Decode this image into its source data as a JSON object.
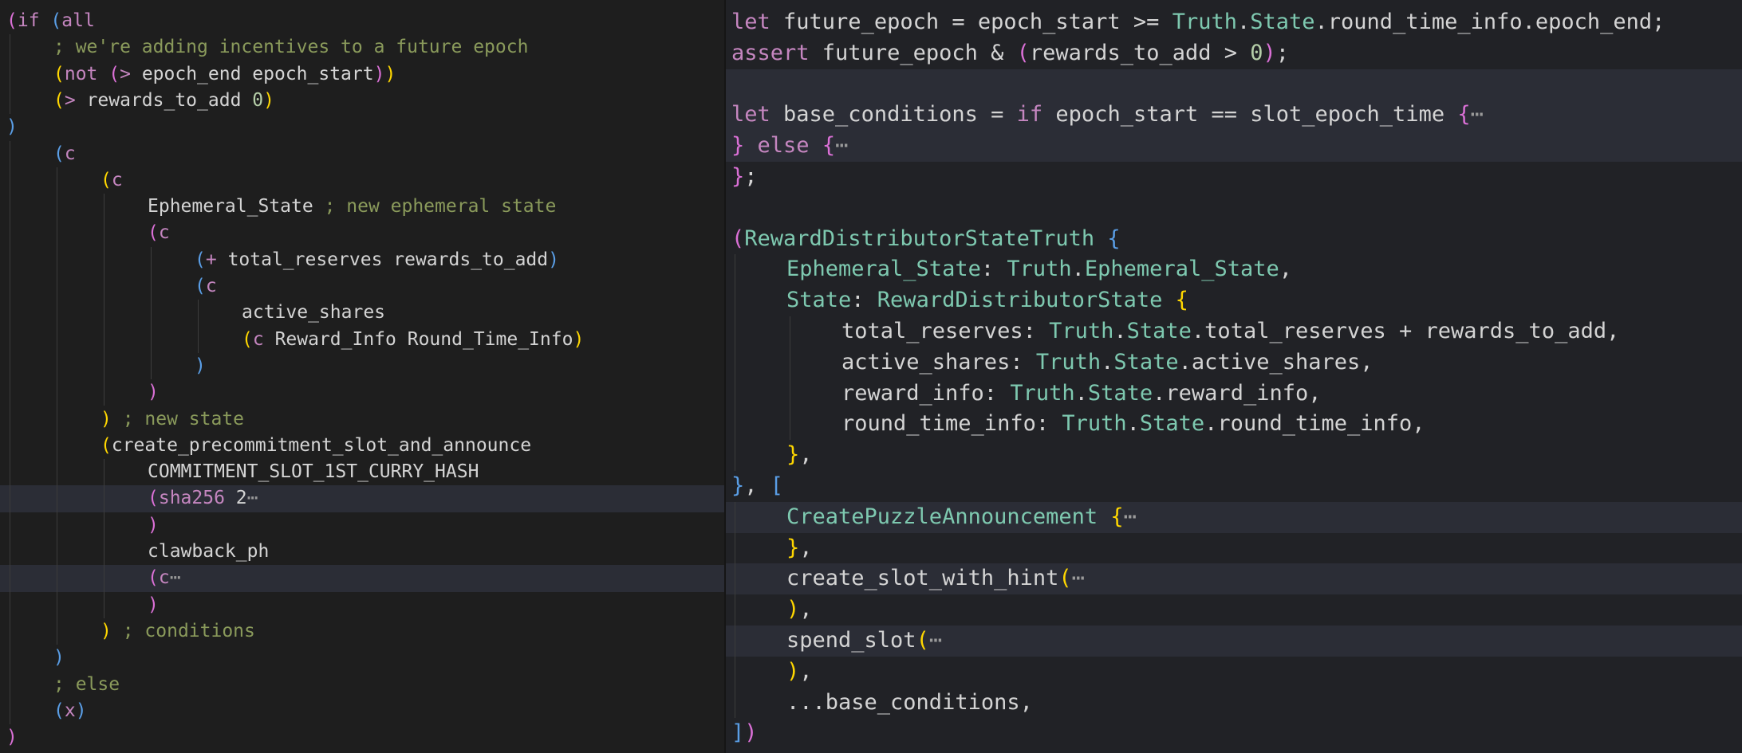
{
  "colors": {
    "background_left": "#1e1e1e",
    "background_right": "#212226",
    "highlight_line": "#2b2d36",
    "text": "#d4d4d4",
    "comment": "#8a9a5b",
    "keyword": "#c586c0",
    "type": "#7ec9b0",
    "number": "#b5cea8",
    "bracket_gold": "#ffd700",
    "bracket_purple": "#da70d6",
    "bracket_blue": "#5a9ee6",
    "property": "#9cdcfe",
    "fold_marker": "#9a9a9a"
  },
  "left_editor": {
    "language": "clvm-lisp",
    "lines": [
      {
        "indent": 0,
        "tokens": [
          {
            "t": "(",
            "c": "bracket_purple"
          },
          {
            "t": "if ",
            "c": "keyword"
          },
          {
            "t": "(",
            "c": "bracket_blue"
          },
          {
            "t": "all",
            "c": "keyword"
          }
        ]
      },
      {
        "indent": 1,
        "tokens": [
          {
            "t": "; we're adding incentives to a future epoch",
            "c": "comment"
          }
        ]
      },
      {
        "indent": 1,
        "tokens": [
          {
            "t": "(",
            "c": "bracket_gold"
          },
          {
            "t": "not ",
            "c": "keyword"
          },
          {
            "t": "(",
            "c": "bracket_purple"
          },
          {
            "t": "> ",
            "c": "keyword"
          },
          {
            "t": "epoch_end epoch_start",
            "c": "text"
          },
          {
            "t": ")",
            "c": "bracket_purple"
          },
          {
            "t": ")",
            "c": "bracket_gold"
          }
        ]
      },
      {
        "indent": 1,
        "tokens": [
          {
            "t": "(",
            "c": "bracket_gold"
          },
          {
            "t": "> ",
            "c": "keyword"
          },
          {
            "t": "rewards_to_add ",
            "c": "text"
          },
          {
            "t": "0",
            "c": "number"
          },
          {
            "t": ")",
            "c": "bracket_gold"
          }
        ]
      },
      {
        "indent": 0,
        "tokens": [
          {
            "t": ")",
            "c": "bracket_blue"
          }
        ]
      },
      {
        "indent": 1,
        "tokens": [
          {
            "t": "(",
            "c": "bracket_blue"
          },
          {
            "t": "c",
            "c": "keyword"
          }
        ]
      },
      {
        "indent": 2,
        "tokens": [
          {
            "t": "(",
            "c": "bracket_gold"
          },
          {
            "t": "c",
            "c": "keyword"
          }
        ]
      },
      {
        "indent": 3,
        "tokens": [
          {
            "t": "Ephemeral_State ",
            "c": "text"
          },
          {
            "t": "; new ephemeral state",
            "c": "comment"
          }
        ]
      },
      {
        "indent": 3,
        "tokens": [
          {
            "t": "(",
            "c": "bracket_purple"
          },
          {
            "t": "c",
            "c": "keyword"
          }
        ]
      },
      {
        "indent": 4,
        "tokens": [
          {
            "t": "(",
            "c": "bracket_blue"
          },
          {
            "t": "+ ",
            "c": "keyword"
          },
          {
            "t": "total_reserves rewards_to_add",
            "c": "text"
          },
          {
            "t": ")",
            "c": "bracket_blue"
          }
        ]
      },
      {
        "indent": 4,
        "tokens": [
          {
            "t": "(",
            "c": "bracket_blue"
          },
          {
            "t": "c",
            "c": "keyword"
          }
        ]
      },
      {
        "indent": 5,
        "tokens": [
          {
            "t": "active_shares",
            "c": "text"
          }
        ]
      },
      {
        "indent": 5,
        "tokens": [
          {
            "t": "(",
            "c": "bracket_gold"
          },
          {
            "t": "c ",
            "c": "keyword"
          },
          {
            "t": "Reward_Info Round_Time_Info",
            "c": "text"
          },
          {
            "t": ")",
            "c": "bracket_gold"
          }
        ]
      },
      {
        "indent": 4,
        "tokens": [
          {
            "t": ")",
            "c": "bracket_blue"
          }
        ]
      },
      {
        "indent": 3,
        "tokens": [
          {
            "t": ")",
            "c": "bracket_purple"
          }
        ]
      },
      {
        "indent": 2,
        "tokens": [
          {
            "t": ")",
            "c": "bracket_gold"
          },
          {
            "t": " ; new state",
            "c": "comment"
          }
        ]
      },
      {
        "indent": 2,
        "tokens": [
          {
            "t": "(",
            "c": "bracket_gold"
          },
          {
            "t": "create_precommitment_slot_and_announce",
            "c": "text"
          }
        ]
      },
      {
        "indent": 3,
        "tokens": [
          {
            "t": "COMMITMENT_SLOT_1ST_CURRY_HASH",
            "c": "text"
          }
        ]
      },
      {
        "indent": 3,
        "highlight": true,
        "tokens": [
          {
            "t": "(",
            "c": "bracket_purple"
          },
          {
            "t": "sha256 ",
            "c": "keyword"
          },
          {
            "t": "2",
            "c": "text"
          },
          {
            "t": "⋯",
            "c": "fold_marker"
          }
        ]
      },
      {
        "indent": 3,
        "tokens": [
          {
            "t": ")",
            "c": "bracket_purple"
          }
        ]
      },
      {
        "indent": 3,
        "tokens": [
          {
            "t": "clawback_ph",
            "c": "text"
          }
        ]
      },
      {
        "indent": 3,
        "highlight": true,
        "tokens": [
          {
            "t": "(",
            "c": "bracket_purple"
          },
          {
            "t": "c",
            "c": "keyword"
          },
          {
            "t": "⋯",
            "c": "fold_marker"
          }
        ]
      },
      {
        "indent": 3,
        "tokens": [
          {
            "t": ")",
            "c": "bracket_purple"
          }
        ]
      },
      {
        "indent": 2,
        "tokens": [
          {
            "t": ")",
            "c": "bracket_gold"
          },
          {
            "t": " ; conditions",
            "c": "comment"
          }
        ]
      },
      {
        "indent": 1,
        "tokens": [
          {
            "t": ")",
            "c": "bracket_blue"
          }
        ]
      },
      {
        "indent": 1,
        "tokens": [
          {
            "t": "; else",
            "c": "comment"
          }
        ]
      },
      {
        "indent": 1,
        "tokens": [
          {
            "t": "(",
            "c": "bracket_blue"
          },
          {
            "t": "x",
            "c": "keyword"
          },
          {
            "t": ")",
            "c": "bracket_blue"
          }
        ]
      },
      {
        "indent": 0,
        "tokens": [
          {
            "t": ")",
            "c": "bracket_purple"
          }
        ]
      }
    ]
  },
  "right_editor": {
    "language": "rust",
    "lines": [
      {
        "indent": 0,
        "tokens": [
          {
            "t": "let ",
            "c": "keyword"
          },
          {
            "t": "future_epoch = epoch_start >= ",
            "c": "text"
          },
          {
            "t": "Truth",
            "c": "type"
          },
          {
            "t": ".",
            "c": "text"
          },
          {
            "t": "State",
            "c": "type"
          },
          {
            "t": ".round_time_info.epoch_end;",
            "c": "text"
          }
        ]
      },
      {
        "indent": 0,
        "tokens": [
          {
            "t": "assert ",
            "c": "keyword"
          },
          {
            "t": "future_epoch & ",
            "c": "text"
          },
          {
            "t": "(",
            "c": "bracket_purple"
          },
          {
            "t": "rewards_to_add > ",
            "c": "text"
          },
          {
            "t": "0",
            "c": "number"
          },
          {
            "t": ")",
            "c": "bracket_purple"
          },
          {
            "t": ";",
            "c": "text"
          }
        ]
      },
      {
        "indent": 0,
        "highlight": true,
        "tokens": []
      },
      {
        "indent": 0,
        "highlight": true,
        "tokens": [
          {
            "t": "let ",
            "c": "keyword"
          },
          {
            "t": "base_conditions = ",
            "c": "text"
          },
          {
            "t": "if ",
            "c": "keyword"
          },
          {
            "t": "epoch_start == slot_epoch_time ",
            "c": "text"
          },
          {
            "t": "{",
            "c": "bracket_purple"
          },
          {
            "t": "⋯",
            "c": "fold_marker"
          }
        ]
      },
      {
        "indent": 0,
        "highlight": true,
        "tokens": [
          {
            "t": "}",
            "c": "bracket_purple"
          },
          {
            "t": " else ",
            "c": "keyword"
          },
          {
            "t": "{",
            "c": "bracket_purple"
          },
          {
            "t": "⋯",
            "c": "fold_marker"
          }
        ]
      },
      {
        "indent": 0,
        "tokens": [
          {
            "t": "}",
            "c": "bracket_purple"
          },
          {
            "t": ";",
            "c": "text"
          }
        ]
      },
      {
        "indent": 0,
        "tokens": []
      },
      {
        "indent": 0,
        "tokens": [
          {
            "t": "(",
            "c": "bracket_purple"
          },
          {
            "t": "RewardDistributorStateTruth ",
            "c": "type"
          },
          {
            "t": "{",
            "c": "bracket_blue"
          }
        ]
      },
      {
        "indent": 1,
        "tokens": [
          {
            "t": "Ephemeral_State",
            "c": "type"
          },
          {
            "t": ": ",
            "c": "text"
          },
          {
            "t": "Truth",
            "c": "type"
          },
          {
            "t": ".",
            "c": "text"
          },
          {
            "t": "Ephemeral_State",
            "c": "type"
          },
          {
            "t": ",",
            "c": "text"
          }
        ]
      },
      {
        "indent": 1,
        "tokens": [
          {
            "t": "State",
            "c": "type"
          },
          {
            "t": ": ",
            "c": "text"
          },
          {
            "t": "RewardDistributorState ",
            "c": "type"
          },
          {
            "t": "{",
            "c": "bracket_gold"
          }
        ]
      },
      {
        "indent": 2,
        "tokens": [
          {
            "t": "total_reserves: ",
            "c": "text"
          },
          {
            "t": "Truth",
            "c": "type"
          },
          {
            "t": ".",
            "c": "text"
          },
          {
            "t": "State",
            "c": "type"
          },
          {
            "t": ".total_reserves + rewards_to_add,",
            "c": "text"
          }
        ]
      },
      {
        "indent": 2,
        "tokens": [
          {
            "t": "active_shares: ",
            "c": "text"
          },
          {
            "t": "Truth",
            "c": "type"
          },
          {
            "t": ".",
            "c": "text"
          },
          {
            "t": "State",
            "c": "type"
          },
          {
            "t": ".active_shares,",
            "c": "text"
          }
        ]
      },
      {
        "indent": 2,
        "tokens": [
          {
            "t": "reward_info: ",
            "c": "text"
          },
          {
            "t": "Truth",
            "c": "type"
          },
          {
            "t": ".",
            "c": "text"
          },
          {
            "t": "State",
            "c": "type"
          },
          {
            "t": ".reward_info,",
            "c": "text"
          }
        ]
      },
      {
        "indent": 2,
        "tokens": [
          {
            "t": "round_time_info: ",
            "c": "text"
          },
          {
            "t": "Truth",
            "c": "type"
          },
          {
            "t": ".",
            "c": "text"
          },
          {
            "t": "State",
            "c": "type"
          },
          {
            "t": ".round_time_info,",
            "c": "text"
          }
        ]
      },
      {
        "indent": 1,
        "tokens": [
          {
            "t": "}",
            "c": "bracket_gold"
          },
          {
            "t": ",",
            "c": "text"
          }
        ]
      },
      {
        "indent": 0,
        "tokens": [
          {
            "t": "}",
            "c": "bracket_blue"
          },
          {
            "t": ", ",
            "c": "text"
          },
          {
            "t": "[",
            "c": "bracket_blue"
          }
        ]
      },
      {
        "indent": 1,
        "highlight": true,
        "tokens": [
          {
            "t": "CreatePuzzleAnnouncement ",
            "c": "type"
          },
          {
            "t": "{",
            "c": "bracket_gold"
          },
          {
            "t": "⋯",
            "c": "fold_marker"
          }
        ]
      },
      {
        "indent": 1,
        "tokens": [
          {
            "t": "}",
            "c": "bracket_gold"
          },
          {
            "t": ",",
            "c": "text"
          }
        ]
      },
      {
        "indent": 1,
        "highlight": true,
        "tokens": [
          {
            "t": "create_slot_with_hint",
            "c": "text"
          },
          {
            "t": "(",
            "c": "bracket_gold"
          },
          {
            "t": "⋯",
            "c": "fold_marker"
          }
        ]
      },
      {
        "indent": 1,
        "tokens": [
          {
            "t": ")",
            "c": "bracket_gold"
          },
          {
            "t": ",",
            "c": "text"
          }
        ]
      },
      {
        "indent": 1,
        "highlight": true,
        "tokens": [
          {
            "t": "spend_slot",
            "c": "text"
          },
          {
            "t": "(",
            "c": "bracket_gold"
          },
          {
            "t": "⋯",
            "c": "fold_marker"
          }
        ]
      },
      {
        "indent": 1,
        "tokens": [
          {
            "t": ")",
            "c": "bracket_gold"
          },
          {
            "t": ",",
            "c": "text"
          }
        ]
      },
      {
        "indent": 1,
        "tokens": [
          {
            "t": "...base_conditions,",
            "c": "text"
          }
        ]
      },
      {
        "indent": 0,
        "tokens": [
          {
            "t": "]",
            "c": "bracket_blue"
          },
          {
            "t": ")",
            "c": "bracket_purple"
          }
        ]
      }
    ]
  }
}
